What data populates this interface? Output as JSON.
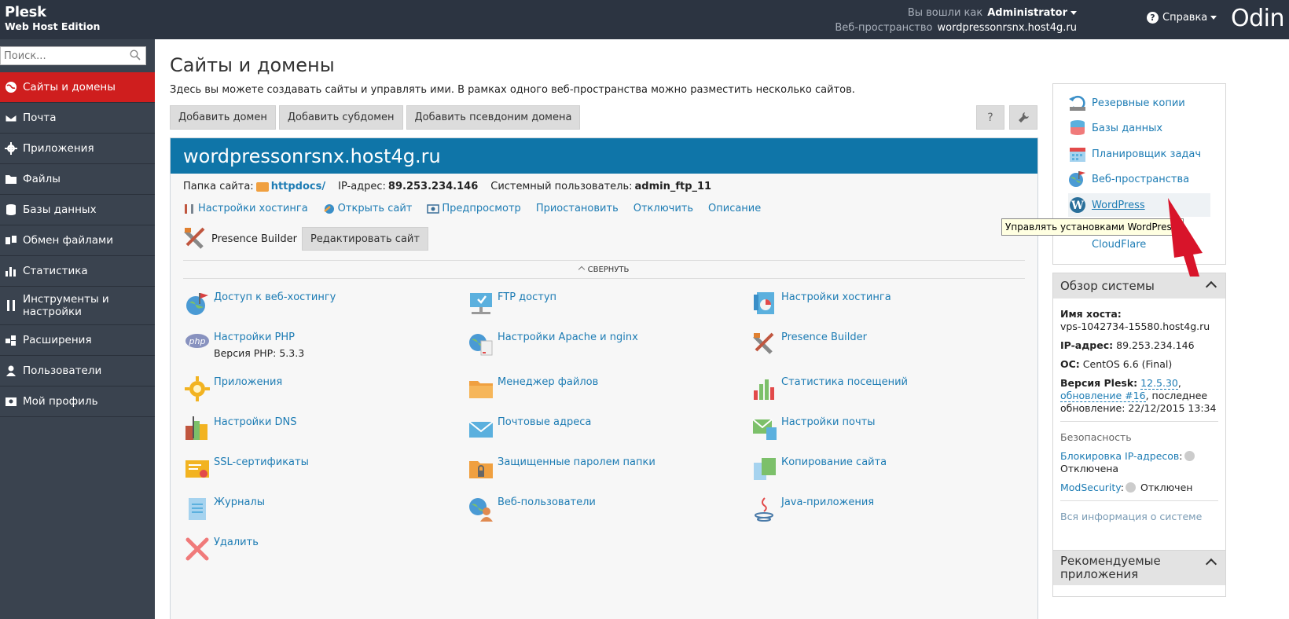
{
  "header": {
    "brand_line1": "Plesk",
    "brand_line2": "Web Host Edition",
    "logged_in_label": "Вы вошли как",
    "logged_in_user": "Administrator",
    "webspace_label": "Веб-пространство",
    "webspace_value": "wordpressonrsnx.host4g.ru",
    "help_label": "Справка",
    "vendor_logo": "Odin"
  },
  "sidebar": {
    "search_placeholder": "Поиск...",
    "items": [
      {
        "label": "Сайты и домены",
        "icon": "globe-icon",
        "active": true
      },
      {
        "label": "Почта",
        "icon": "mail-icon"
      },
      {
        "label": "Приложения",
        "icon": "gear-icon"
      },
      {
        "label": "Файлы",
        "icon": "folder-icon"
      },
      {
        "label": "Базы данных",
        "icon": "database-icon"
      },
      {
        "label": "Обмен файлами",
        "icon": "share-icon"
      },
      {
        "label": "Статистика",
        "icon": "bar-chart-icon"
      },
      {
        "label": "Инструменты и настройки",
        "icon": "tools-icon"
      },
      {
        "label": "Расширения",
        "icon": "puzzle-icon"
      },
      {
        "label": "Пользователи",
        "icon": "user-icon"
      },
      {
        "label": "Мой профиль",
        "icon": "profile-icon"
      }
    ]
  },
  "main": {
    "title": "Сайты и домены",
    "description": "Здесь вы можете создавать сайты и управлять ими. В рамках одного веб-пространства можно разместить несколько сайтов.",
    "buttons": {
      "add_domain": "Добавить домен",
      "add_subdomain": "Добавить субдомен",
      "add_alias": "Добавить псевдоним домена",
      "help": "?"
    },
    "domain": {
      "name": "wordpressonrsnx.host4g.ru",
      "folder_label": "Папка сайта:",
      "folder_value": "httpdocs/",
      "ip_label": "IP-адрес:",
      "ip_value": "89.253.234.146",
      "sysuser_label": "Системный пользователь:",
      "sysuser_value": "admin_ftp_11",
      "links": [
        "Настройки хостинга",
        "Открыть сайт",
        "Предпросмотр",
        "Приостановить",
        "Отключить",
        "Описание"
      ],
      "presence_builder": "Presence Builder",
      "edit_site": "Редактировать сайт",
      "collapse": "СВЕРНУТЬ",
      "tiles": [
        {
          "label": "Доступ к веб-хостингу",
          "icon": "globe-flag-icon"
        },
        {
          "label": "FTP доступ",
          "icon": "ftp-icon"
        },
        {
          "label": "Настройки хостинга",
          "icon": "hosting-settings-icon"
        },
        {
          "label": "Настройки PHP",
          "sub": "Версия PHP: 5.3.3",
          "icon": "php-icon"
        },
        {
          "label": "Настройки Apache и nginx",
          "icon": "server-globe-icon"
        },
        {
          "label": "Presence Builder",
          "icon": "builder-icon"
        },
        {
          "label": "Приложения",
          "icon": "sun-gear-icon"
        },
        {
          "label": "Менеджер файлов",
          "icon": "file-manager-icon"
        },
        {
          "label": "Статистика посещений",
          "icon": "stats-icon"
        },
        {
          "label": "Настройки DNS",
          "icon": "dns-icon"
        },
        {
          "label": "Почтовые адреса",
          "icon": "envelope-icon"
        },
        {
          "label": "Настройки почты",
          "icon": "mail-settings-icon"
        },
        {
          "label": "SSL-сертификаты",
          "icon": "ssl-icon"
        },
        {
          "label": "Защищенные паролем папки",
          "icon": "locked-folder-icon"
        },
        {
          "label": "Копирование сайта",
          "icon": "copy-site-icon"
        },
        {
          "label": "Журналы",
          "icon": "logs-icon"
        },
        {
          "label": "Веб-пользователи",
          "icon": "web-users-icon"
        },
        {
          "label": "Java-приложения",
          "icon": "java-icon"
        },
        {
          "label": "Удалить",
          "icon": "delete-icon"
        }
      ]
    }
  },
  "right": {
    "quick_links": [
      {
        "label": "Резервные копии",
        "icon": "backup-icon"
      },
      {
        "label": "Базы данных",
        "icon": "database-icon"
      },
      {
        "label": "Планировщик задач",
        "icon": "calendar-icon"
      },
      {
        "label": "Веб-пространства",
        "icon": "webspace-icon"
      },
      {
        "label": "WordPress",
        "icon": "wordpress-icon"
      },
      {
        "label": "CloudFlare",
        "icon": "cloudflare-icon"
      }
    ],
    "tooltip": "Управлять установками WordPress.",
    "system": {
      "title": "Обзор системы",
      "hostname_label": "Имя хоста:",
      "hostname_value": "vps-1042734-15580.host4g.ru",
      "ip_label": "IP-адрес:",
      "ip_value": "89.253.234.146",
      "os_label": "ОС:",
      "os_value": "CentOS 6.6 (Final)",
      "plesk_label": "Версия Plesk:",
      "plesk_version": "12.5.30",
      "plesk_update": "обновление #16",
      "last_update_label": ", последнее обновление:",
      "last_update_value": "22/12/2015 13:34",
      "security_label": "Безопасность",
      "ip_block_label": "Блокировка IP-адресов",
      "ip_block_status": "Отключена",
      "modsec_label": "ModSecurity",
      "modsec_status": "Отключен",
      "all_info": "Вся информация о системе"
    },
    "recommended": {
      "title": "Рекомендуемые приложения"
    }
  },
  "colors": {
    "header_bg": "#2c3441",
    "sidebar_bg": "#3a434f",
    "active_red": "#cf1e1e",
    "domain_blue": "#0f75a8",
    "link_blue": "#1d7cb4"
  }
}
